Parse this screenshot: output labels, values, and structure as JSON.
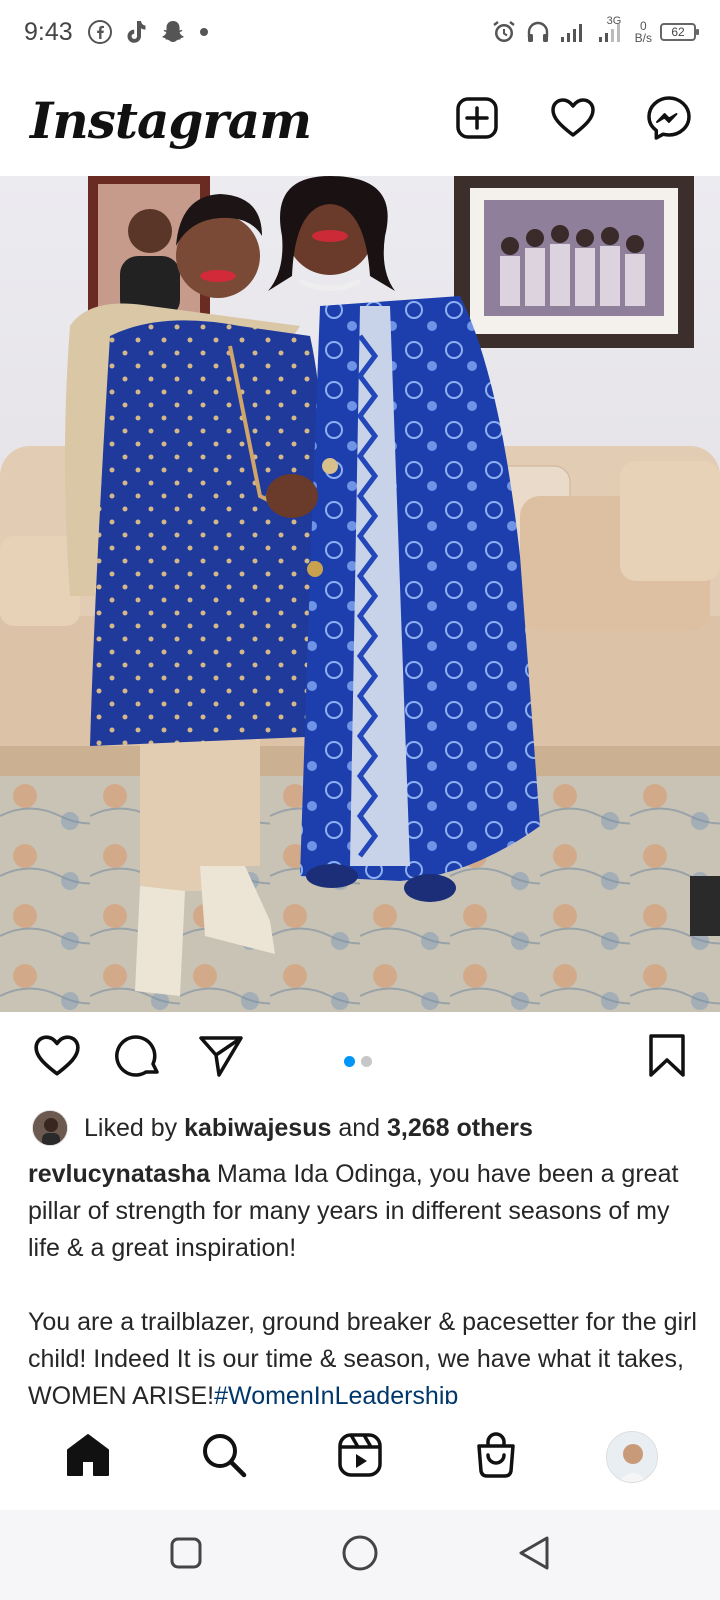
{
  "status_bar": {
    "time": "9:43",
    "network_type": "3G",
    "net_speed_value": "0",
    "net_speed_unit": "B/s",
    "battery": "62"
  },
  "header": {
    "logo": "Instagram",
    "icons": [
      "new-post-icon",
      "heart-icon",
      "messenger-icon"
    ]
  },
  "post": {
    "carousel": {
      "count": 2,
      "active": 1
    },
    "likes": {
      "prefix": "Liked by",
      "user": "kabiwajesus",
      "connector": "and",
      "others": "3,268 others"
    },
    "caption": {
      "username": "revlucynatasha",
      "paragraph1": "Mama Ida Odinga, you have been a great pillar of strength for many years in different seasons of my life & a great inspiration!",
      "paragraph2": "You are a trailblazer, ground breaker & pacesetter for the girl child! Indeed It is our time & season, we have what it takes, WOMEN ARISE!",
      "hashtag": "#WomenInLeadership"
    }
  },
  "bottom_nav": [
    "home-icon",
    "search-icon",
    "reels-icon",
    "shop-icon",
    "profile-avatar"
  ],
  "colors": {
    "accent_blue": "#0095f6",
    "hashtag": "#00376b",
    "text": "#262626"
  }
}
